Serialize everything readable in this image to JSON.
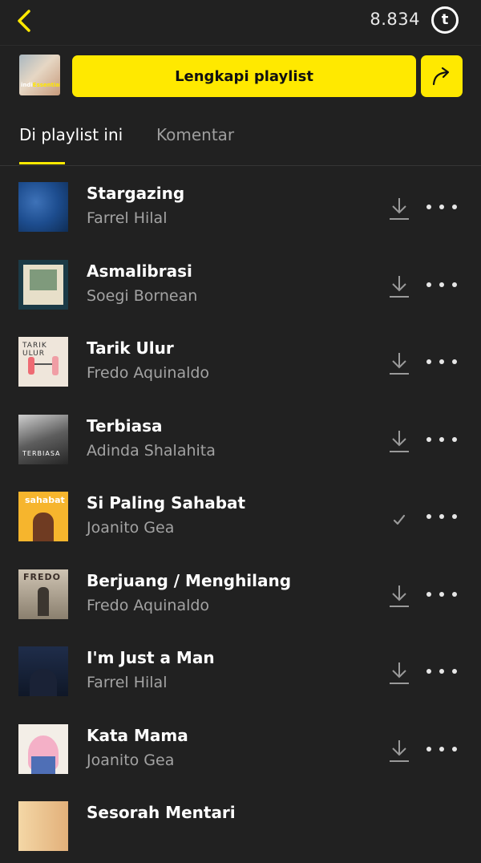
{
  "header": {
    "back_icon": "chevron-left-icon",
    "coin_count": "8.834",
    "coin_icon_letter": "t"
  },
  "actions": {
    "playlist_cover_text_a": "indi",
    "playlist_cover_text_b": "Essentials",
    "complete_playlist_label": "Lengkapi playlist",
    "share_icon": "share-arrow-icon"
  },
  "tabs": [
    {
      "label": "Di playlist ini",
      "active": true
    },
    {
      "label": "Komentar",
      "active": false
    }
  ],
  "songs": [
    {
      "title": "Stargazing",
      "artist": "Farrel Hilal",
      "downloaded": false
    },
    {
      "title": "Asmalibrasi",
      "artist": "Soegi Bornean",
      "downloaded": false
    },
    {
      "title": "Tarik Ulur",
      "artist": "Fredo Aquinaldo",
      "downloaded": false,
      "cover_text": "TARIK ULUR"
    },
    {
      "title": "Terbiasa",
      "artist": "Adinda Shalahita",
      "downloaded": false,
      "cover_text": "TERBIASA"
    },
    {
      "title": "Si Paling Sahabat",
      "artist": "Joanito Gea",
      "downloaded": true,
      "cover_text": "sahabat"
    },
    {
      "title": "Berjuang / Menghilang",
      "artist": "Fredo Aquinaldo",
      "downloaded": false,
      "cover_text": "FREDO"
    },
    {
      "title": "I'm Just a Man",
      "artist": "Farrel Hilal",
      "downloaded": false
    },
    {
      "title": "Kata Mama",
      "artist": "Joanito Gea",
      "downloaded": false
    },
    {
      "title": "Sesorah Mentari",
      "artist": "",
      "downloaded": false
    }
  ],
  "colors": {
    "accent": "#ffe900",
    "background": "#212121",
    "secondary_text": "#a3a3a3"
  }
}
